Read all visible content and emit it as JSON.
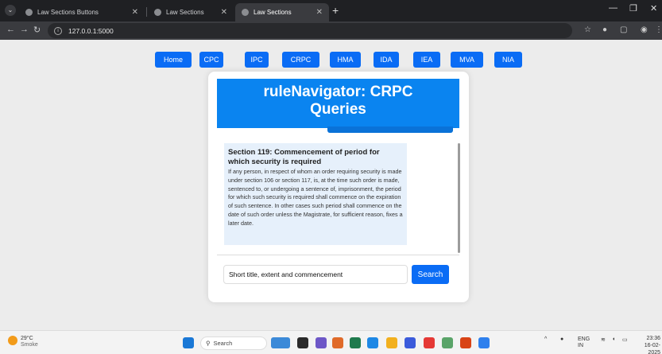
{
  "browser": {
    "tabs": [
      {
        "title": "Law Sections Buttons"
      },
      {
        "title": "Law Sections"
      },
      {
        "title": "Law Sections"
      }
    ],
    "url": "127.0.0.1:5000"
  },
  "nav": {
    "buttons": [
      "Home",
      "CPC",
      "IPC",
      "CRPC",
      "HMA",
      "IDA",
      "IEA",
      "MVA",
      "NIA"
    ]
  },
  "hero": {
    "title_line1": "ruleNavigator: CRPC",
    "title_line2": "Queries"
  },
  "result": {
    "title": "Section 119: Commencement of period for which security is required",
    "body": "If any person, in respect of whom an order requiring security is made under section 106 or section 117, is, at the time such order is made, sentenced to, or undergoing a sentence of, imprisonment, the period for which such security is required shall commence on the expiration of such sentence. In other cases such period shall commence on the date of such order unless the Magistrate, for sufficient reason, fixes a later date."
  },
  "search": {
    "value": "Short title, extent and commencement",
    "button_label": "Search"
  },
  "taskbar": {
    "weather_temp": "29°C",
    "weather_desc": "Smoke",
    "search_placeholder": "Search",
    "lang": "ENG",
    "region": "IN",
    "time": "23:36",
    "date": "16-02-2025"
  },
  "colors": {
    "accent": "#0a6cf5",
    "hero": "#0a84f0",
    "result_bg": "#e6f0fb"
  }
}
